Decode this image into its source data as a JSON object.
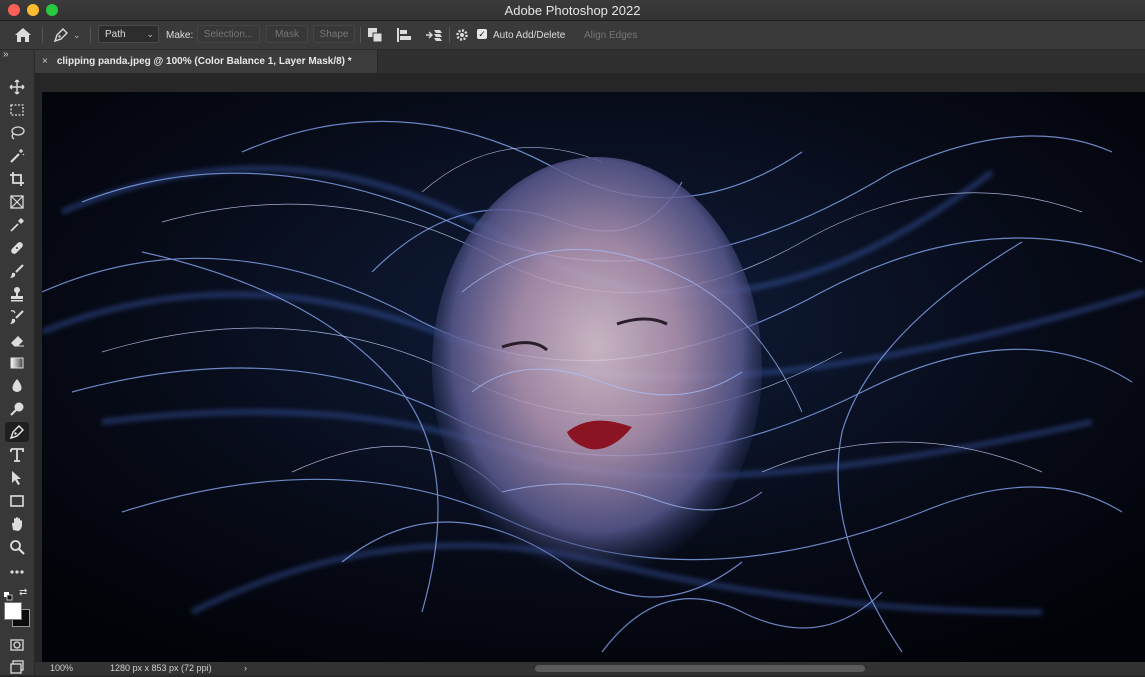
{
  "window": {
    "title": "Adobe Photoshop 2022"
  },
  "options_bar": {
    "mode_value": "Path",
    "make_label": "Make:",
    "selection_label": "Selection...",
    "mask_label": "Mask",
    "shape_label": "Shape",
    "auto_add_delete_label": "Auto Add/Delete",
    "auto_add_delete_checked": "✓",
    "align_edges_label": "Align Edges"
  },
  "document": {
    "tab_close": "×",
    "tab_title": "clipping panda.jpeg @ 100% (Color Balance 1, Layer Mask/8) *"
  },
  "toolbar": {
    "collapse_glyph": "»",
    "tools": [
      "move-icon",
      "marquee-icon",
      "lasso-icon",
      "magic-wand-icon",
      "crop-icon",
      "frame-icon",
      "eyedropper-icon",
      "healing-brush-icon",
      "brush-icon",
      "clone-stamp-icon",
      "history-brush-icon",
      "eraser-icon",
      "gradient-icon",
      "blur-icon",
      "dodge-icon",
      "pen-icon",
      "type-icon",
      "path-selection-icon",
      "rectangle-icon",
      "hand-icon",
      "zoom-icon",
      "more-tools-icon"
    ],
    "active_tool": "pen-icon"
  },
  "status": {
    "zoom": "100%",
    "doc_info": "1280 px x 853 px (72 ppi)",
    "arrow": "›"
  },
  "colors": {
    "accent": "#28c840",
    "panel": "#3a3a3a",
    "canvas_bg": "#262626"
  }
}
